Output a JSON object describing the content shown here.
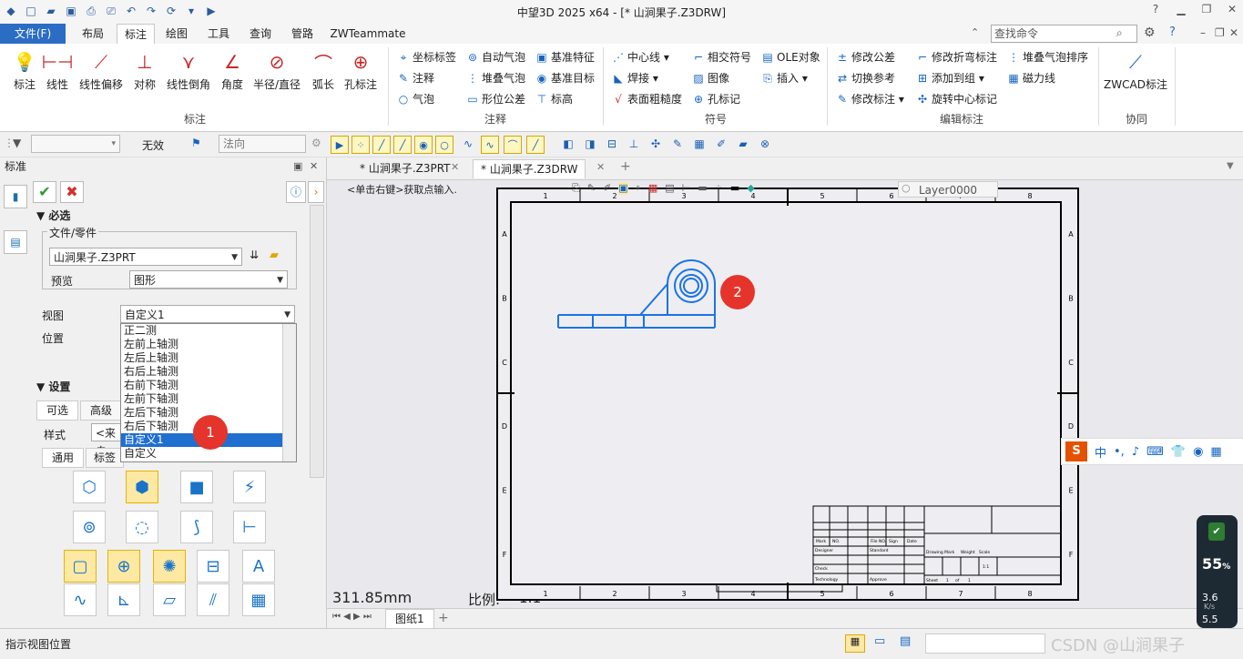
{
  "window": {
    "title": "中望3D 2025 x64 - [* 山涧果子.Z3DRW]"
  },
  "menu": {
    "file": "文件(F)",
    "tabs": [
      "布局",
      "标注",
      "绘图",
      "工具",
      "查询",
      "管路",
      "ZWTeammate"
    ],
    "search_placeholder": "查找命令"
  },
  "ribbon": {
    "dimension": {
      "buttons": [
        "标注",
        "线性",
        "线性偏移",
        "对称",
        "线性倒角",
        "角度",
        "半径/直径",
        "弧长",
        "孔标注"
      ],
      "group": "标注"
    },
    "annotation": {
      "col1": [
        "坐标标签",
        "注释",
        "气泡"
      ],
      "col2": [
        "自动气泡",
        "堆叠气泡",
        "形位公差"
      ],
      "col3": [
        "基准特征",
        "基准目标",
        "标高"
      ],
      "group": "注释"
    },
    "symbol": {
      "col1": [
        "中心线",
        "焊接",
        "表面粗糙度"
      ],
      "col2": [
        "相交符号",
        "图像",
        "孔标记"
      ],
      "col3": [
        "OLE对象",
        "插入"
      ],
      "group": "符号"
    },
    "edit": {
      "col1": [
        "修改公差",
        "切换参考",
        "修改标注"
      ],
      "col2": [
        "修改折弯标注",
        "添加到组",
        "旋转中心标记"
      ],
      "col3": [
        "堆叠气泡排序",
        "磁力线"
      ],
      "group": "编辑标注"
    },
    "collab": {
      "button": "ZWCAD标注",
      "group": "协同"
    }
  },
  "toolbar2": {
    "invalid": "无效",
    "normal": "法向"
  },
  "left_panel": {
    "title": "标准",
    "required": "必选",
    "file_part": "文件/零件",
    "file_value": "山涧果子.Z3PRT",
    "preview_label": "预览",
    "preview_value": "图形",
    "view_label": "视图",
    "view_value": "自定义1",
    "position_label": "位置",
    "view_options": [
      "正二测",
      "左前上轴测",
      "左后上轴测",
      "右后上轴测",
      "右前下轴测",
      "左前下轴测",
      "左后下轴测",
      "右后下轴测",
      "自定义1",
      "自定义"
    ],
    "selected_option": "自定义1",
    "settings": "设置",
    "tab_optional": "可选",
    "tab_advanced": "高级",
    "style_label": "样式",
    "style_value": "<来自",
    "subtab_general": "通用",
    "subtab_label": "标签"
  },
  "badges": {
    "one": "1",
    "two": "2"
  },
  "document": {
    "tabs": [
      "* 山涧果子.Z3PRT",
      "* 山涧果子.Z3DRW"
    ],
    "hint": "<单击右键>获取点输入.",
    "layer": "Layer0000",
    "length": "311.85mm",
    "scale_label": "比例:",
    "scale_value": "1:1",
    "sheet": "图纸1",
    "col_labels": [
      "1",
      "2",
      "3",
      "4",
      "5",
      "6",
      "7",
      "8"
    ],
    "row_labels": [
      "A",
      "B",
      "C",
      "D",
      "E",
      "F"
    ]
  },
  "title_block": {
    "mark": "Mark",
    "no": "NO.",
    "file_no": "File NO.",
    "sign": "Sign",
    "date": "Date",
    "designer": "Designer",
    "standard": "Standard",
    "check": "Check",
    "technology": "Technology",
    "approve": "Approve",
    "drawing_mark": "Drawing Mark",
    "weight": "Weight",
    "scale": "Scale",
    "ratio": "1:1",
    "sheet": "Sheet",
    "sheet_no": "1",
    "of": "of",
    "sheet_total": "1"
  },
  "status": {
    "hint": "指示视图位置",
    "watermark": "CSDN @山涧果子"
  },
  "ime": {
    "zh": "中"
  },
  "perf": {
    "percent": "55",
    "pct_sign": "%",
    "up": "3.6",
    "unit": "K/s",
    "down": "5.5"
  },
  "colors": {
    "accent": "#2b6cc4",
    "badge": "#e5342b",
    "model_line": "#1a73e8"
  }
}
